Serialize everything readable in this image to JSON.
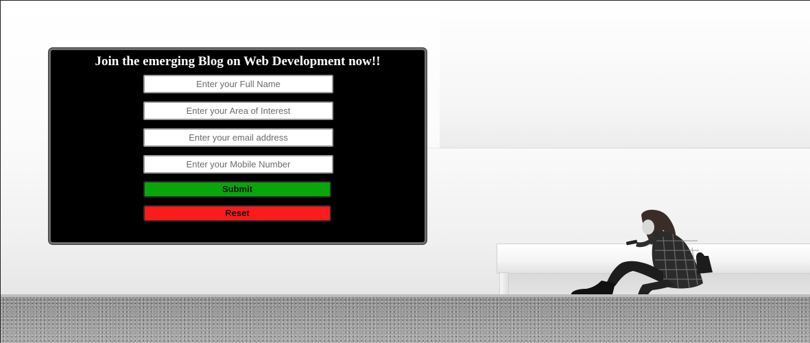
{
  "form": {
    "title": "Join the emerging Blog on Web Development now!!",
    "fields": [
      {
        "placeholder": "Enter your Full Name",
        "value": ""
      },
      {
        "placeholder": "Enter your Area of Interest",
        "value": ""
      },
      {
        "placeholder": "Enter your email address",
        "value": ""
      },
      {
        "placeholder": "Enter your Mobile Number",
        "value": ""
      }
    ],
    "submit_label": "Submit",
    "reset_label": "Reset"
  },
  "colors": {
    "panel_background": "#000000",
    "submit_button": "#09a60a",
    "reset_button": "#fb1b1b",
    "title_text": "#ffffff"
  },
  "background": {
    "scene": "grayscale-photo-woman-on-bench"
  }
}
